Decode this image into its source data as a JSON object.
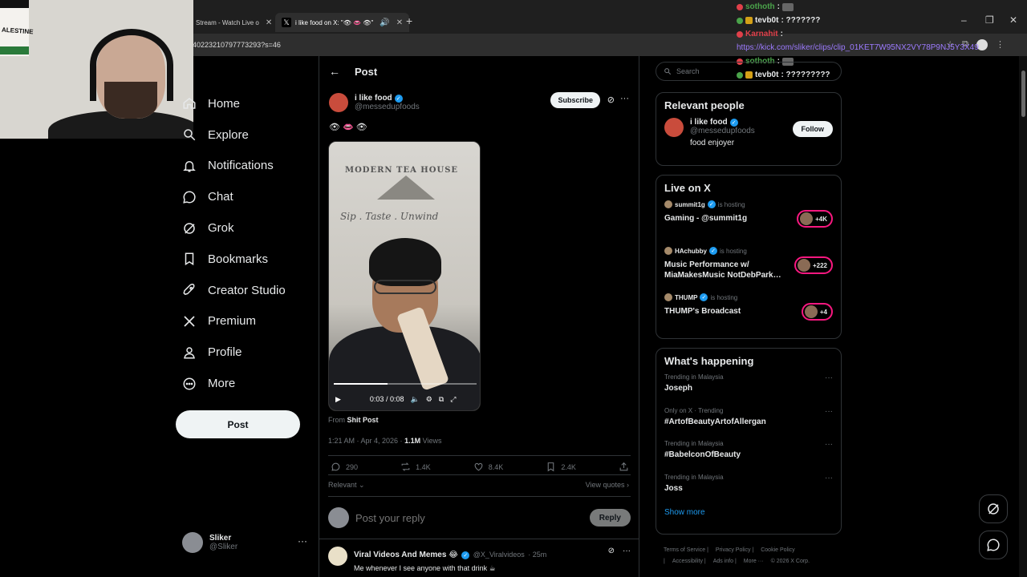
{
  "browser": {
    "tabs": [
      {
        "label": "Stream - Watch Live o",
        "active": false
      },
      {
        "label": "i like food on X: \"👁 👄 👁\"",
        "active": true
      }
    ],
    "url": "40223210797773293?s=46",
    "new_tab": "+",
    "win_min": "–",
    "win_max": "❐",
    "win_close": "✕"
  },
  "webcam": {
    "flag_text": "ALESTINE"
  },
  "chat": {
    "lines": [
      {
        "user": "sothoth",
        "msg": ":",
        "color": "#4aa34a"
      },
      {
        "user": "tevb0t",
        "msg": ": ???????",
        "color": "#e7e9ea"
      },
      {
        "user": "Karnahit",
        "msg": ":",
        "color": "#e0404a"
      },
      {
        "user": "",
        "msg": "https://kick.com/sliker/clips/clip_01KET7W95NX2VY78P9NJ5Y3X49",
        "color": "#9d7bff",
        "link": true
      },
      {
        "user": "sothoth",
        "msg": ":",
        "color": "#4aa34a"
      },
      {
        "user": "tevb0t",
        "msg": ": ?????????",
        "color": "#e7e9ea"
      }
    ]
  },
  "nav": {
    "items": [
      {
        "label": "Home",
        "icon": "home-icon"
      },
      {
        "label": "Explore",
        "icon": "search-icon"
      },
      {
        "label": "Notifications",
        "icon": "bell-icon"
      },
      {
        "label": "Chat",
        "icon": "chat-bubble-icon"
      },
      {
        "label": "Grok",
        "icon": "grok-icon"
      },
      {
        "label": "Bookmarks",
        "icon": "bookmark-icon"
      },
      {
        "label": "Creator Studio",
        "icon": "rocket-icon"
      },
      {
        "label": "Premium",
        "icon": "x-logo-icon"
      },
      {
        "label": "Profile",
        "icon": "person-icon"
      },
      {
        "label": "More",
        "icon": "more-circle-icon"
      }
    ],
    "post_label": "Post"
  },
  "account": {
    "name": "Sliker",
    "handle": "@Sliker",
    "more": "···"
  },
  "main": {
    "header_title": "Post",
    "back": "←",
    "author": {
      "name": "i like food",
      "handle": "@messedupfoods"
    },
    "subscribe_label": "Subscribe",
    "post_text": "👁 👄 👁",
    "video": {
      "sign_title": "MODERN TEA HOUSE",
      "sign_sub": "Sip . Taste . Unwind",
      "time": "0:03 / 0:08",
      "progress": 0.375
    },
    "from_prefix": "From",
    "from_source": "Shit Post",
    "timestamp": "1:21 AM · Apr 4, 2026 ·",
    "views_count": "1.1M",
    "views_label": "Views",
    "stats": {
      "replies": "290",
      "reposts": "1.4K",
      "likes": "8.4K",
      "bookmarks": "2.4K"
    },
    "relevant_label": "Relevant ⌄",
    "view_quotes": "View quotes ›",
    "reply_placeholder": "Post your reply",
    "reply_button": "Reply",
    "reply": {
      "name": "Viral Videos And Memes 😂",
      "handle": "@X_Viralvideos",
      "time": "· 25m",
      "text": "Me whenever I see anyone with that drink ☕"
    }
  },
  "right": {
    "search_placeholder": "Search",
    "relevant_people": {
      "title": "Relevant people",
      "name": "i like food",
      "handle": "@messedupfoods",
      "bio": "food enjoyer",
      "follow_label": "Follow"
    },
    "live": {
      "title": "Live on X",
      "items": [
        {
          "host": "summit1g",
          "status": "is hosting",
          "title": "Gaming - @summit1g",
          "count": "+4K"
        },
        {
          "host": "HAchubby",
          "status": "is hosting",
          "title": "Music Performance w/ MiaMakesMusic NotDebPark…",
          "count": "+222"
        },
        {
          "host": "THUMP",
          "status": "is hosting",
          "title": "THUMP's Broadcast",
          "count": "+4"
        }
      ]
    },
    "happening": {
      "title": "What's happening",
      "items": [
        {
          "context": "Trending in Malaysia",
          "name": "Joseph"
        },
        {
          "context": "Only on X · Trending",
          "name": "#ArtofBeautyArtofAllergan"
        },
        {
          "context": "Trending in Malaysia",
          "name": "#BabelconOfBeauty"
        },
        {
          "context": "Trending in Malaysia",
          "name": "Joss"
        }
      ],
      "show_more": "Show more"
    },
    "footer": [
      "Terms of Service |",
      "Privacy Policy |",
      "Cookie Policy |",
      "Accessibility |",
      "Ads info |",
      "More ···",
      "© 2026 X Corp."
    ]
  }
}
